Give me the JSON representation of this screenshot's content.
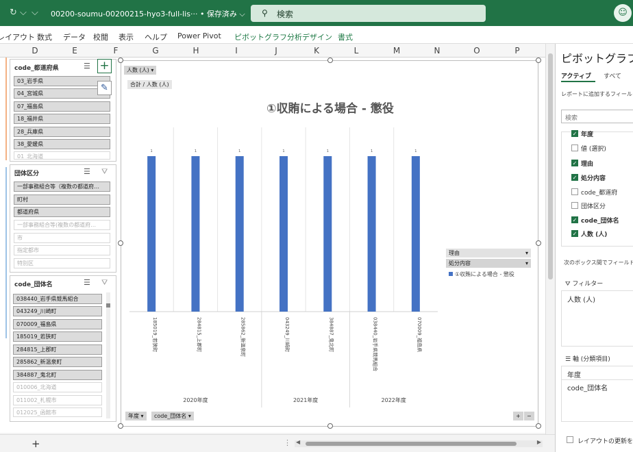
{
  "titlebar": {
    "doc_name": "00200-soumu-00200215-hyo3-full-lis··· • 保存済み ⌵",
    "search_label": "検索",
    "avatar": "☺"
  },
  "menu": [
    "レイアウト",
    "数式",
    "データ",
    "校閲",
    "表示",
    "ヘルプ",
    "Power Pivot",
    "ピボットグラフ分析",
    "デザイン",
    "書式"
  ],
  "columns": [
    "D",
    "E",
    "F",
    "G",
    "H",
    "I",
    "J",
    "K",
    "L",
    "M",
    "N",
    "O",
    "P"
  ],
  "slicers": [
    {
      "title": "code_都道府県",
      "items": [
        {
          "label": "03_岩手県",
          "on": true
        },
        {
          "label": "04_宮城県",
          "on": true
        },
        {
          "label": "07_福島県",
          "on": true
        },
        {
          "label": "18_福井県",
          "on": true
        },
        {
          "label": "28_兵庫県",
          "on": true
        },
        {
          "label": "38_愛媛県",
          "on": true
        },
        {
          "label": "01_北海道",
          "on": false
        }
      ]
    },
    {
      "title": "団体区分",
      "items": [
        {
          "label": "一部事務組合等（複数の都道府…",
          "on": true
        },
        {
          "label": "町村",
          "on": true
        },
        {
          "label": "都道府県",
          "on": true
        },
        {
          "label": "一部事務組合等(複数の都道府…",
          "on": false
        },
        {
          "label": "市",
          "on": false
        },
        {
          "label": "指定都市",
          "on": false
        },
        {
          "label": "特別区",
          "on": false
        }
      ]
    },
    {
      "title": "code_団体名",
      "items": [
        {
          "label": "038440_岩手県競馬組合",
          "on": true
        },
        {
          "label": "043249_川崎町",
          "on": true
        },
        {
          "label": "070009_福島県",
          "on": true
        },
        {
          "label": "185019_若狭町",
          "on": true
        },
        {
          "label": "284815_上郡町",
          "on": true
        },
        {
          "label": "285862_新温泉町",
          "on": true
        },
        {
          "label": "384887_鬼北町",
          "on": true
        },
        {
          "label": "010006_北海道",
          "on": false
        },
        {
          "label": "011002_札幌市",
          "on": false
        },
        {
          "label": "012025_函館市",
          "on": false
        }
      ]
    }
  ],
  "chart": {
    "value_field_button": "人数 (人)",
    "sum_label": "合計 / 人数 (人)",
    "legend_field_1": "理由",
    "legend_field_2": "処分内容",
    "axis_field_1": "年度",
    "axis_field_2": "code_団体名"
  },
  "chart_data": {
    "type": "bar",
    "title": "①収賄による場合 - 懲役",
    "categories": [
      "185019_若狭町",
      "284815_上郡町",
      "285862_新温泉町",
      "043249_川崎町",
      "384887_鬼北町",
      "038440_岩手県競馬組合",
      "070009_福島県"
    ],
    "groups": [
      {
        "label": "2020年度",
        "count": 3
      },
      {
        "label": "2021年度",
        "count": 2
      },
      {
        "label": "2022年度",
        "count": 2
      }
    ],
    "series": [
      {
        "name": "①収賄による場合 - 懲役",
        "values": [
          1,
          1,
          1,
          1,
          1,
          1,
          1
        ]
      }
    ],
    "data_labels": [
      "1",
      "1",
      "1",
      "1",
      "1",
      "1",
      "1"
    ],
    "ylim": [
      0,
      1
    ],
    "bar_color": "#4472c4"
  },
  "panel": {
    "title": "ピボットグラフの",
    "tab_active": "アクティブ",
    "tab_all": "すべて",
    "hint": "レポートに追加するフィール",
    "search_placeholder": "検索",
    "fields": [
      {
        "label": "年度",
        "on": true
      },
      {
        "label": "値 (選択)",
        "on": false
      },
      {
        "label": "理由",
        "on": true
      },
      {
        "label": "処分内容",
        "on": true
      },
      {
        "label": "code_都道府",
        "on": false
      },
      {
        "label": "団体区分",
        "on": false
      },
      {
        "label": "code_団体名",
        "on": true
      },
      {
        "label": "人数 (人)",
        "on": true
      }
    ],
    "drag_hint": "次のボックス間でフィールド",
    "filter_label": "フィルター",
    "filter_item": "人数 (人)",
    "axis_label": "軸 (分類項目)",
    "axis_items": [
      "年度",
      "code_団体名"
    ],
    "defer_label": "レイアウトの更新を保"
  },
  "status": {
    "add_sheet": "+"
  }
}
